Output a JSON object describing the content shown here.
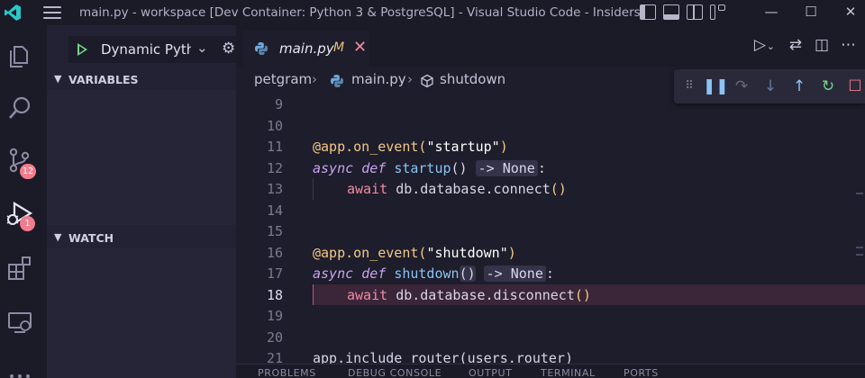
{
  "titlebar": {
    "title": "main.py - workspace [Dev Container: Python 3 & PostgreSQL] - Visual Studio Code - Insiders",
    "minimize": "—",
    "maximize": "☐",
    "close": "✕"
  },
  "activity": {
    "scm_badge": "12",
    "debug_badge": "1"
  },
  "sidebar": {
    "debug_config": "Dynamic Python",
    "variables_label": "VARIABLES",
    "watch_label": "WATCH"
  },
  "editor": {
    "tab": {
      "label": "main.py",
      "modified": "M"
    },
    "breadcrumb": {
      "folder": "petgram",
      "file": "main.py",
      "symbol": "shutdown"
    },
    "lines": [
      {
        "n": "9"
      },
      {
        "n": "10"
      },
      {
        "n": "11",
        "decorator": "@app.on_event(",
        "arg": "\"startup\"",
        "close": ")"
      },
      {
        "n": "12",
        "kw1": "async",
        "kw2": "def",
        "fn": "startup",
        "parens": "()",
        "inlay": "-> None",
        "colon": ":"
      },
      {
        "n": "13",
        "await": "await",
        "call": "db.database.connect",
        "parens": "()"
      },
      {
        "n": "14"
      },
      {
        "n": "15"
      },
      {
        "n": "16",
        "decorator": "@app.on_event(",
        "arg": "\"shutdown\"",
        "close": ")"
      },
      {
        "n": "17",
        "kw1": "async",
        "kw2": "def",
        "fn": "shutdown",
        "parens": "()",
        "inlay": "-> None",
        "colon": ":"
      },
      {
        "n": "18",
        "await": "await",
        "call": "db.database.disconnect",
        "parens": "()"
      },
      {
        "n": "19"
      },
      {
        "n": "20"
      },
      {
        "n": "21",
        "text": "app.include_router(users.router)"
      }
    ],
    "panel_tabs": [
      "PROBLEMS",
      "DEBUG CONSOLE",
      "OUTPUT",
      "TERMINAL",
      "PORTS"
    ]
  },
  "colors": {
    "accent_green": "#74d68a",
    "badge": "#f27c8c",
    "current_line": "#3a2539"
  }
}
